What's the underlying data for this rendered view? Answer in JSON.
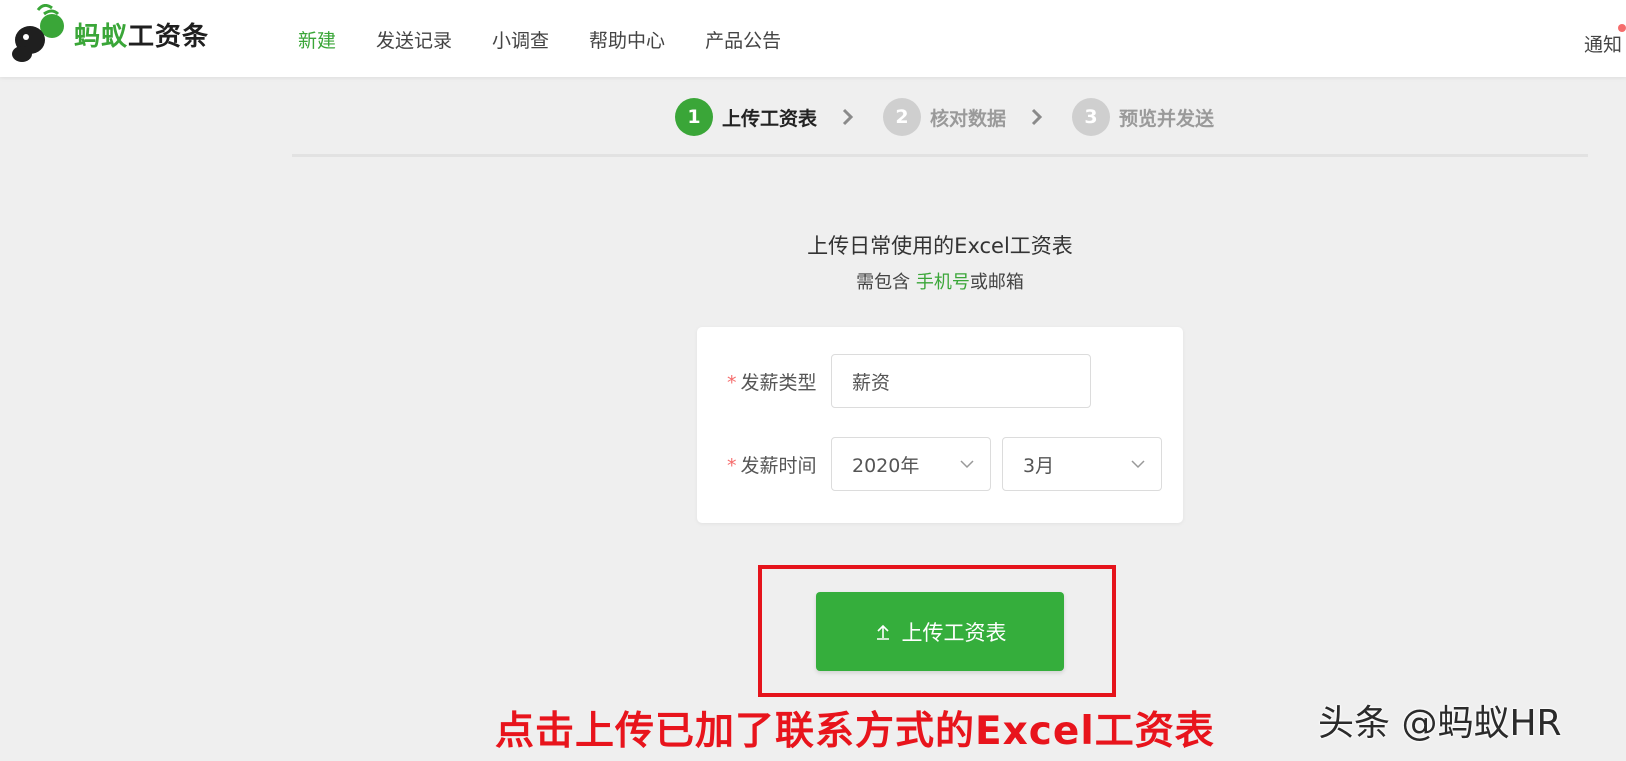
{
  "header": {
    "brand_green": "蚂蚁",
    "brand_dark": "工资条",
    "nav": [
      {
        "label": "新建",
        "active": true
      },
      {
        "label": "发送记录"
      },
      {
        "label": "小调查"
      },
      {
        "label": "帮助中心"
      },
      {
        "label": "产品公告"
      }
    ],
    "notification": "通知"
  },
  "steps": [
    {
      "num": "1",
      "label": "上传工资表",
      "active": true
    },
    {
      "num": "2",
      "label": "核对数据"
    },
    {
      "num": "3",
      "label": "预览并发送"
    }
  ],
  "intro": {
    "title": "上传日常使用的Excel工资表",
    "sub_prefix": "需包含 ",
    "sub_highlight": "手机号",
    "sub_suffix": "或邮箱"
  },
  "form": {
    "required_mark": "*",
    "pay_type_label": "发薪类型",
    "pay_type_value": "薪资",
    "pay_time_label": "发薪时间",
    "year_value": "2020年",
    "month_value": "3月"
  },
  "upload_button": "上传工资表",
  "annotation": "点击上传已加了联系方式的Excel工资表",
  "watermark": "头条 @蚂蚁HR",
  "colors": {
    "brand_green": "#3aa638",
    "button_green": "#35ae3c",
    "annotation_red": "#e8141c",
    "required_red": "#f56c6c",
    "page_bg": "#efefef"
  },
  "icons": [
    "ant-logo-icon",
    "chevron-right-icon",
    "chevron-down-icon",
    "upload-icon"
  ]
}
